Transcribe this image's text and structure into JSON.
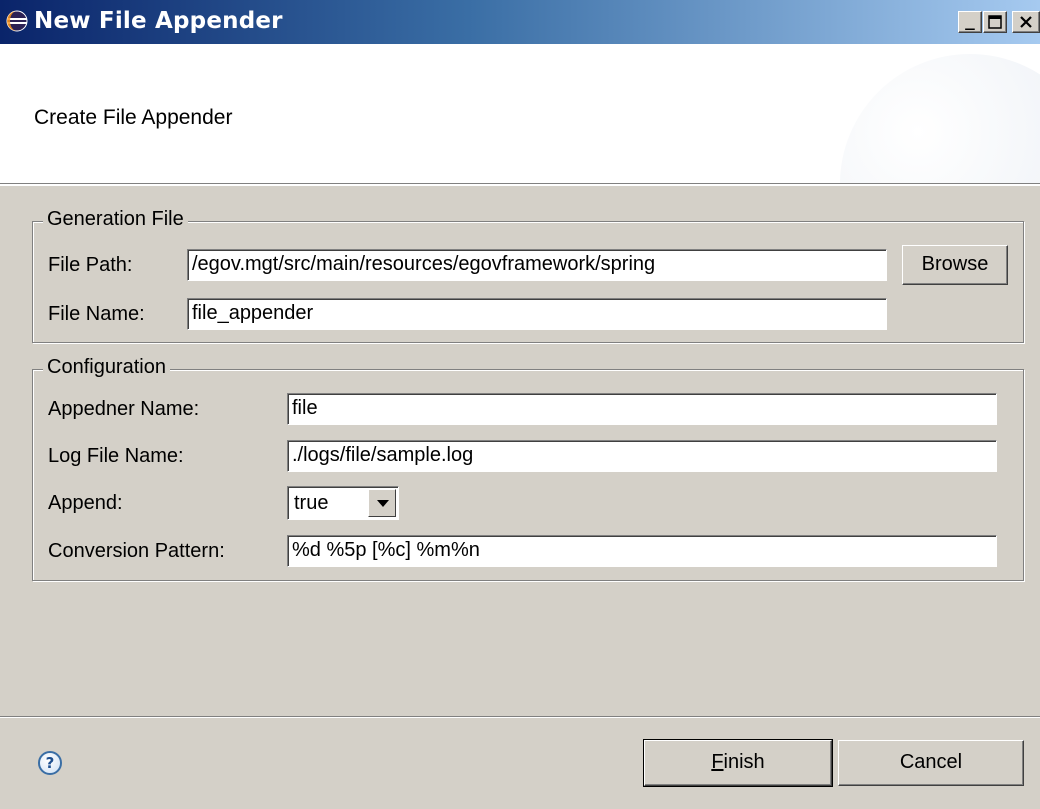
{
  "window": {
    "title": "New File Appender"
  },
  "banner": {
    "title": "Create File Appender"
  },
  "generation_file": {
    "legend": "Generation File",
    "file_path_label": "File Path:",
    "file_path_value": "/egov.mgt/src/main/resources/egovframework/spring",
    "browse_label": "Browse",
    "file_name_label": "File Name:",
    "file_name_value": "file_appender"
  },
  "configuration": {
    "legend": "Configuration",
    "appender_name_label": "Appedner Name:",
    "appender_name_value": "file",
    "log_file_name_label": "Log File Name:",
    "log_file_name_value": "./logs/file/sample.log",
    "append_label": "Append:",
    "append_value": "true",
    "conversion_pattern_label": "Conversion Pattern:",
    "conversion_pattern_value": "%d %5p [%c] %m%n"
  },
  "footer": {
    "help_glyph": "?",
    "finish_prefix": "",
    "finish_mnemonic": "F",
    "finish_rest": "inish",
    "cancel_label": "Cancel"
  },
  "colors": {
    "titlebar_start": "#0a246a",
    "titlebar_end": "#a6caf0",
    "dialog_bg": "#d4d0c8"
  },
  "icons": {
    "title": "eclipse-icon",
    "help": "help-icon",
    "minimize": "minimize-icon",
    "maximize": "maximize-icon",
    "close": "close-icon",
    "dropdown": "chevron-down-icon"
  }
}
